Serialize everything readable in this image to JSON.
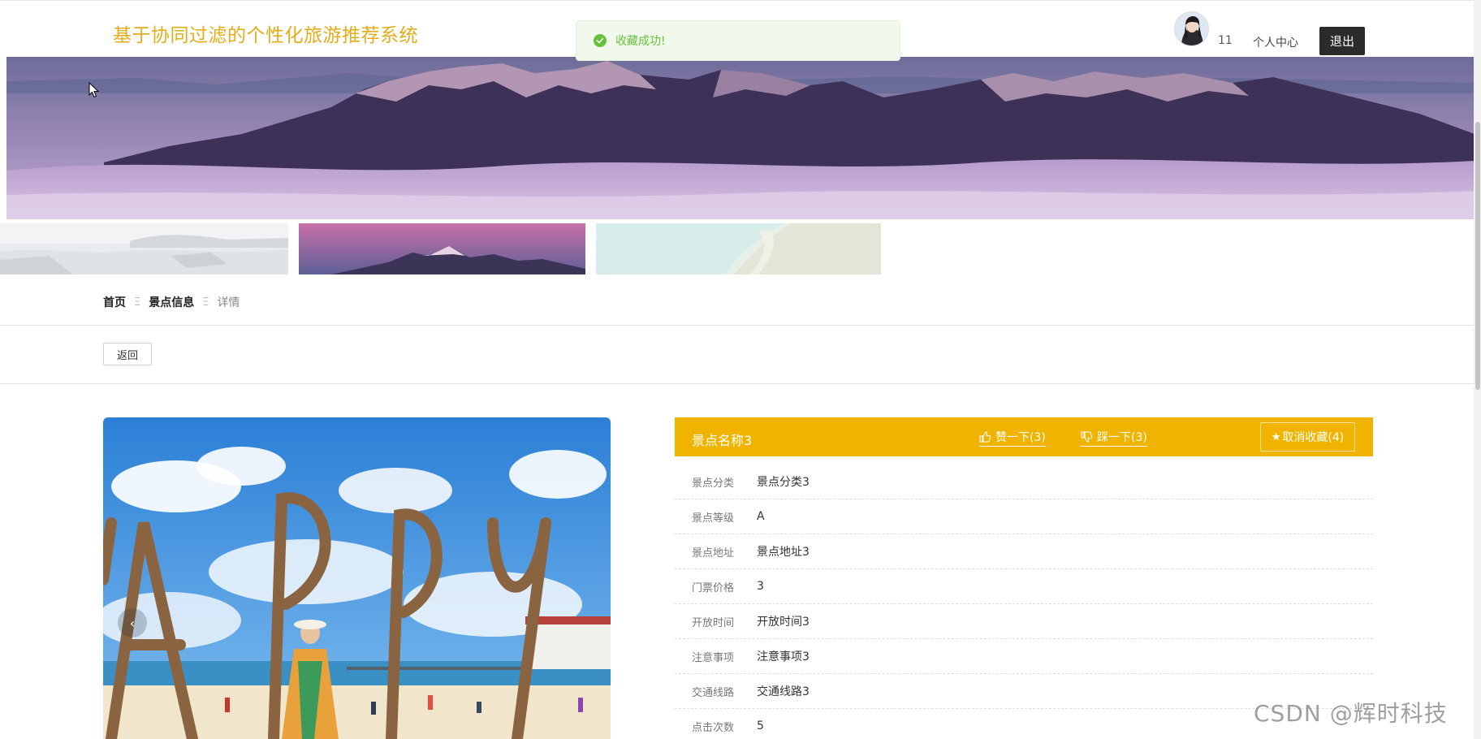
{
  "header": {
    "site_title": "基于协同过滤的个性化旅游推荐系统",
    "username": "11",
    "center_label": "个人中心",
    "logout_label": "退出"
  },
  "toast": {
    "message": "收藏成功!",
    "icon": "check-circle-icon",
    "color": "#67c23a"
  },
  "breadcrumb": {
    "home": "首页",
    "section": "景点信息",
    "current": "详情",
    "separator": "Ξ"
  },
  "actions": {
    "back_label": "返回"
  },
  "carousel": {
    "prev_icon": "‹"
  },
  "detail": {
    "name": "景点名称3",
    "like_label": "赞一下(3)",
    "dislike_label": "踩一下(3)",
    "favorite_label": "取消收藏(4)",
    "accent_color": "#f0b400",
    "fields": [
      {
        "label": "景点分类",
        "value": "景点分类3"
      },
      {
        "label": "景点等级",
        "value": "A"
      },
      {
        "label": "景点地址",
        "value": "景点地址3"
      },
      {
        "label": "门票价格",
        "value": "3"
      },
      {
        "label": "开放时间",
        "value": "开放时间3"
      },
      {
        "label": "注意事项",
        "value": "注意事项3"
      },
      {
        "label": "交通线路",
        "value": "交通线路3"
      },
      {
        "label": "点击次数",
        "value": "5"
      }
    ]
  },
  "watermark": "CSDN @辉时科技"
}
